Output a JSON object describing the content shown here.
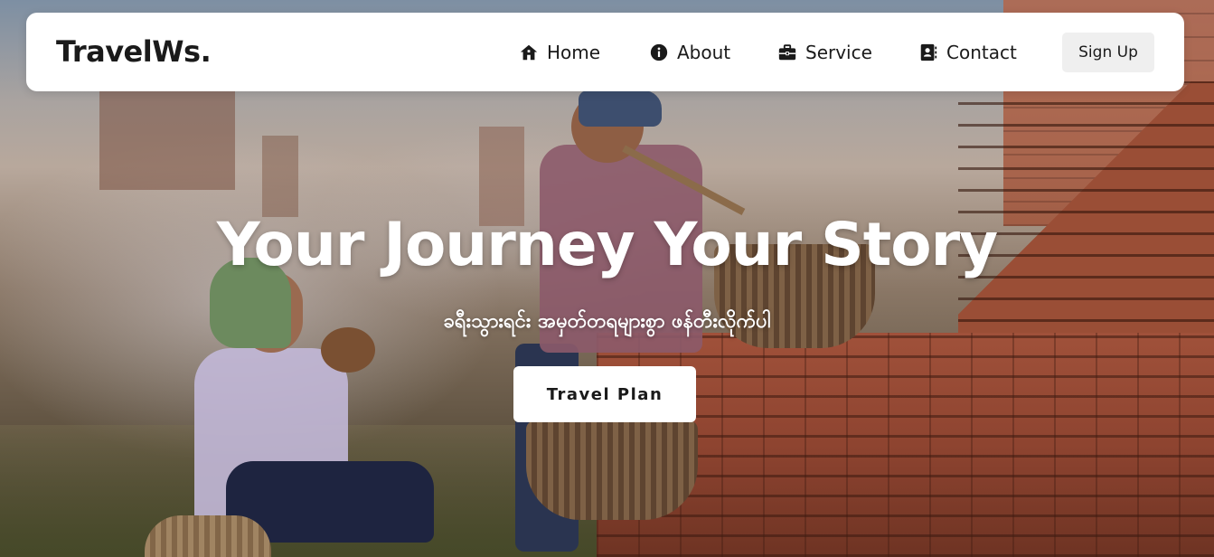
{
  "navbar": {
    "brand": "TravelWs.",
    "items": [
      {
        "label": "Home",
        "icon": "home-icon"
      },
      {
        "label": "About",
        "icon": "info-icon"
      },
      {
        "label": "Service",
        "icon": "briefcase-icon"
      },
      {
        "label": "Contact",
        "icon": "contact-book-icon"
      }
    ],
    "signup_label": "Sign Up"
  },
  "hero": {
    "title": "Your Journey Your Story",
    "subtitle": "ခရီးသွားရင်း အမှတ်တရများစွာ ဖန်တီးလိုက်ပါ",
    "cta_label": "Travel Plan",
    "background_image": "two elderly women with baskets beside ancient brick temple ruins"
  },
  "colors": {
    "navbar_bg": "#ffffff",
    "text_dark": "#1a1a1a",
    "signup_bg": "#efefef",
    "hero_text": "#ffffff"
  }
}
